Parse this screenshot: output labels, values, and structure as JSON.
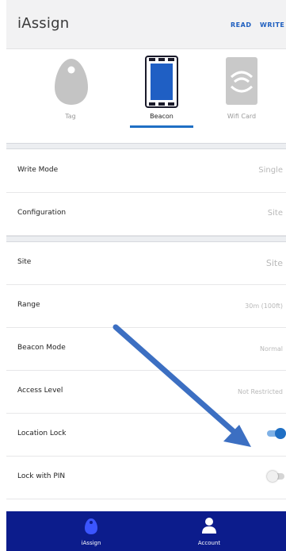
{
  "header": {
    "title": "iAssign",
    "read_label": "READ",
    "write_label": "WRITE"
  },
  "device_tabs": [
    {
      "label": "Tag",
      "icon": "key-fob-tag-icon",
      "active": false
    },
    {
      "label": "Beacon",
      "icon": "beacon-device-icon",
      "active": true
    },
    {
      "label": "Wifi Card",
      "icon": "wifi-card-icon",
      "active": false
    }
  ],
  "settings": {
    "write_mode": {
      "label": "Write Mode",
      "value": "Single"
    },
    "configuration": {
      "label": "Configuration",
      "value": "Site"
    },
    "site": {
      "label": "Site",
      "value": "Site"
    },
    "range": {
      "label": "Range",
      "value": "30m (100ft)"
    },
    "beacon_mode": {
      "label": "Beacon Mode",
      "value": "Normal"
    },
    "access_level": {
      "label": "Access Level",
      "value": "Not Restricted"
    },
    "location_lock": {
      "label": "Location Lock",
      "on": true
    },
    "lock_with_pin": {
      "label": "Lock with PIN",
      "on": false
    }
  },
  "bottom_nav": {
    "assign_label": "iAssign",
    "account_label": "Account"
  },
  "colors": {
    "accent": "#1f6fc4",
    "nav_background": "#0c1c8c",
    "annotation_arrow": "#3c6fc2"
  }
}
